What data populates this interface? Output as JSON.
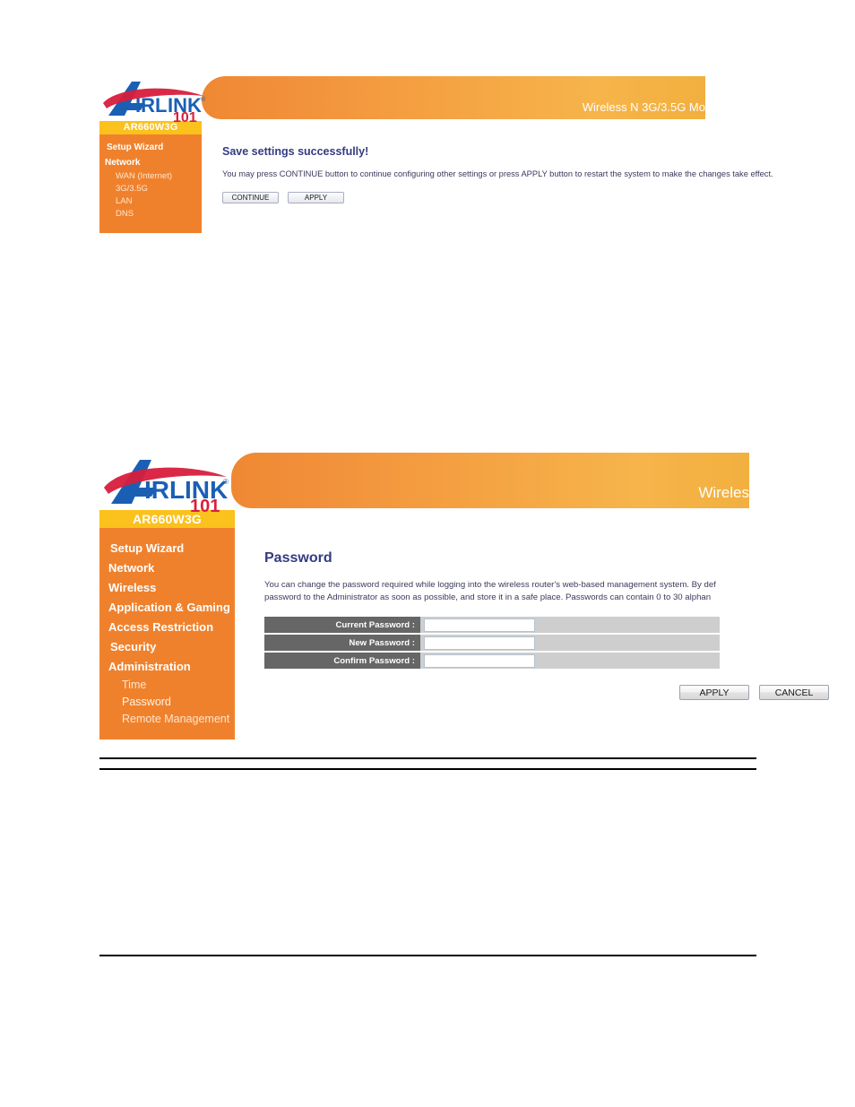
{
  "document": {
    "figures": [
      {
        "id": "figure-save-settings",
        "brand": {
          "logo_text_primary": "IRLINK",
          "logo_letter": "A",
          "logo_registered": "®",
          "logo_text_secondary": "101"
        },
        "header": {
          "title": "Wireless N 3G/3.5G Mo"
        },
        "sidebar": {
          "model": "AR660W3G",
          "items": [
            {
              "label": "Setup Wizard",
              "level": "top",
              "active": false
            },
            {
              "label": "Network",
              "level": "top",
              "active": false
            },
            {
              "label": "WAN (Internet)",
              "level": "sub",
              "active": false
            },
            {
              "label": "3G/3.5G",
              "level": "sub",
              "active": false
            },
            {
              "label": "LAN",
              "level": "sub",
              "active": false
            },
            {
              "label": "DNS",
              "level": "sub",
              "active": false
            }
          ]
        },
        "content": {
          "title": "Save settings successfully!",
          "description": "You may press CONTINUE button to continue configuring other settings or press APPLY button to restart the system to make the changes take effect.",
          "buttons": [
            {
              "label": "CONTINUE"
            },
            {
              "label": "APPLY"
            }
          ]
        }
      },
      {
        "id": "figure-password",
        "brand": {
          "logo_text_primary": "IRLINK",
          "logo_letter": "A",
          "logo_registered": "®",
          "logo_text_secondary": "101"
        },
        "header": {
          "title": "Wireles"
        },
        "sidebar": {
          "model": "AR660W3G",
          "items": [
            {
              "label": "Setup Wizard",
              "level": "top",
              "active": false
            },
            {
              "label": "Network",
              "level": "top",
              "active": false
            },
            {
              "label": "Wireless",
              "level": "top",
              "active": false
            },
            {
              "label": "Application & Gaming",
              "level": "top",
              "active": false
            },
            {
              "label": "Access Restriction",
              "level": "top",
              "active": false
            },
            {
              "label": "Security",
              "level": "top",
              "active": false
            },
            {
              "label": "Administration",
              "level": "top",
              "active": false
            },
            {
              "label": "Time",
              "level": "sub",
              "active": false
            },
            {
              "label": "Password",
              "level": "sub",
              "active": true
            },
            {
              "label": "Remote Management",
              "level": "sub",
              "active": false
            }
          ]
        },
        "content": {
          "title": "Password",
          "description_line1": "You can change the password required while logging into the wireless router's web-based management system. By def",
          "description_line2": "password to the Administrator as soon as possible, and store it in a safe place. Passwords can contain 0 to 30 alphan",
          "fields": [
            {
              "label": "Current Password :",
              "value": "",
              "type": "password"
            },
            {
              "label": "New Password :",
              "value": "",
              "type": "password"
            },
            {
              "label": "Confirm Password :",
              "value": "",
              "type": "password"
            }
          ],
          "buttons": [
            {
              "label": "APPLY"
            },
            {
              "label": "CANCEL"
            }
          ]
        }
      }
    ],
    "colors": {
      "sidebar_orange": "#f0812c",
      "model_yellow": "#fbc11c",
      "header_orange_left": "#ef8833",
      "header_orange_right": "#f2b03f",
      "title_navy": "#333b82",
      "form_label_gray": "#666666",
      "form_value_gray": "#cecece",
      "logo_blue": "#1a5fb4",
      "logo_red": "#d81e3c"
    }
  }
}
